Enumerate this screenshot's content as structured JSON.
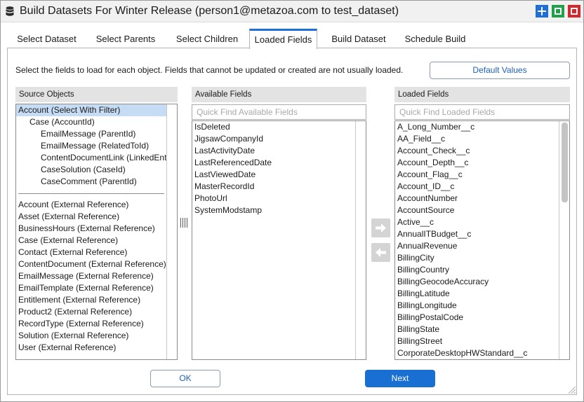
{
  "window": {
    "title": "Build Datasets For Winter Release (person1@metazoa.com to test_dataset)",
    "icon": "database-icon",
    "colors": {
      "maximize": "#1e6fd9",
      "restore": "#21a04a",
      "close": "#d9262b"
    }
  },
  "tabs": [
    {
      "label": "Select Dataset",
      "active": false
    },
    {
      "label": "Select Parents",
      "active": false
    },
    {
      "label": "Select Children",
      "active": false
    },
    {
      "label": "Loaded Fields",
      "active": true
    },
    {
      "label": "Build Dataset",
      "active": false
    },
    {
      "label": "Schedule Build",
      "active": false
    }
  ],
  "instructions": "Select the fields to load for each object. Fields that cannot be updated or created are not usually loaded.",
  "default_values_label": "Default Values",
  "source": {
    "header": "Source Objects",
    "tree": [
      {
        "label": "Account (Select With Filter)",
        "selected": true
      },
      {
        "label": "Case (AccountId)"
      },
      {
        "label": "EmailMessage (ParentId)"
      },
      {
        "label": "EmailMessage (RelatedToId)"
      },
      {
        "label": "ContentDocumentLink (LinkedEntityId)"
      },
      {
        "label": "CaseSolution (CaseId)"
      },
      {
        "label": "CaseComment (ParentId)"
      }
    ],
    "references": [
      "Account (External Reference)",
      "Asset (External Reference)",
      "BusinessHours (External Reference)",
      "Case (External Reference)",
      "Contact (External Reference)",
      "ContentDocument (External Reference)",
      "EmailMessage (External Reference)",
      "EmailTemplate (External Reference)",
      "Entitlement (External Reference)",
      "Product2 (External Reference)",
      "RecordType (External Reference)",
      "Solution (External Reference)",
      "User (External Reference)"
    ]
  },
  "available": {
    "header": "Available Fields",
    "search_placeholder": "Quick Find Available Fields",
    "fields": [
      "IsDeleted",
      "JigsawCompanyId",
      "LastActivityDate",
      "LastReferencedDate",
      "LastViewedDate",
      "MasterRecordId",
      "PhotoUrl",
      "SystemModstamp"
    ]
  },
  "loaded": {
    "header": "Loaded Fields",
    "search_placeholder": "Quick Find Loaded Fields",
    "fields": [
      "A_Long_Number__c",
      "AA_Field__c",
      "Account_Check__c",
      "Account_Depth__c",
      "Account_Flag__c",
      "Account_ID__c",
      "AccountNumber",
      "AccountSource",
      "Active__c",
      "AnnualITBudget__c",
      "AnnualRevenue",
      "BillingCity",
      "BillingCountry",
      "BillingGeocodeAccuracy",
      "BillingLatitude",
      "BillingLongitude",
      "BillingPostalCode",
      "BillingState",
      "BillingStreet",
      "CorporateDesktopHWStandard__c"
    ]
  },
  "buttons": {
    "ok": "OK",
    "next": "Next"
  },
  "accent_color": "#1a6fd3"
}
